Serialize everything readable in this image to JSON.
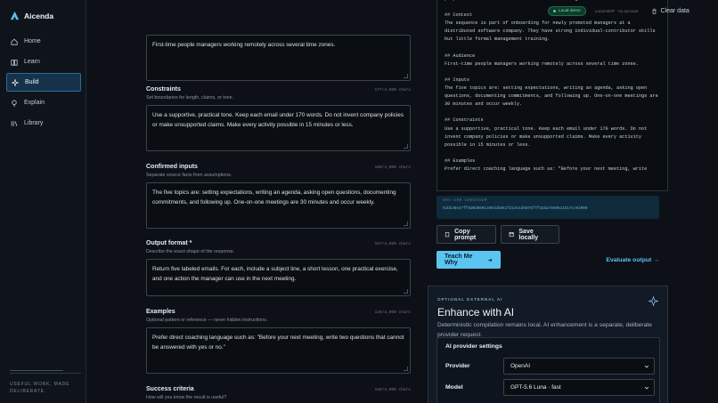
{
  "app": {
    "name": "Aicenda"
  },
  "sidebar": {
    "items": [
      {
        "label": "Home",
        "icon": "home-icon",
        "active": false
      },
      {
        "label": "Learn",
        "icon": "book-icon",
        "active": false
      },
      {
        "label": "Build",
        "icon": "sparkle-icon",
        "active": true
      },
      {
        "label": "Explain",
        "icon": "lightbulb-icon",
        "active": false
      },
      {
        "label": "Library",
        "icon": "library-icon",
        "active": false
      }
    ],
    "tagline": "USEFUL WORK, MADE DELIBERATE."
  },
  "form": {
    "audience_value": "First-time people managers working remotely across several time zones.",
    "constraints": {
      "label": "Constraints",
      "count": "177/4,000 chars",
      "desc": "Set boundaries for length, claims, or tone.",
      "value": "Use a supportive, practical tone. Keep each email under 170 words. Do not invent company policies or make unsupported claims. Make every activity possible in 15 minutes or less."
    },
    "inputs": {
      "label": "Confirmed inputs",
      "count": "180/4,000 chars",
      "desc": "Separate source facts from assumptions.",
      "value": "The five topics are: setting expectations, writing an agenda, asking open questions, documenting commitments, and following up. One-on-one meetings are 30 minutes and occur weekly."
    },
    "output": {
      "label": "Output format *",
      "count": "157/4,000 chars",
      "desc": "Describe the exact shape of the response.",
      "value": "Return five labeled emails. For each, include a subject line, a short lesson, one practical exercise, and one action the manager can use in the next meeting."
    },
    "examples": {
      "label": "Examples",
      "count": "120/4,000 chars",
      "desc": "Optional pattern or reference — never hidden instructions.",
      "value": "Prefer direct coaching language such as: \"Before your next meeting, write two questions that cannot be answered with yes or no.\""
    },
    "success": {
      "label": "Success criteria",
      "count": "158/4,000 chars",
      "desc": "How will you know the result is useful?"
    }
  },
  "topbar": {
    "demo_label": "Local demo",
    "mvp_note": "Local MVP · no account",
    "clear_label": "Clear data"
  },
  "output": {
    "text": "purpose for and can effective and in the meetings.\n\n## Context\nThe sequence is part of onboarding for newly promoted managers at a distributed software company. They have strong individual-contributor skills but little formal management training.\n\n## Audience\nFirst-time people managers working remotely across several time zones.\n\n## Inputs\nThe five topics are: setting expectations, writing an agenda, asking open questions, documenting commitments, and following up. One-on-one meetings are 30 minutes and occur weekly.\n\n## Constraints\nUse a supportive, practical tone. Keep each email under 170 words. Do not invent company policies or make unsupported claims. Make every activity possible in 15 minutes or less.\n\n## Examples\nPrefer direct coaching language such as: \"Before your next meeting, write",
    "checksum_label": "SHA-256 CHECKSUM",
    "checksum_value": "51bb48e47ff6d0d8001399cbb861f213e1d5875f7f32ba78e0621517cc02000",
    "copy_label": "Copy prompt",
    "save_label": "Save locally",
    "teach_label": "Teach Me Why",
    "eval_label": "Evaluate output"
  },
  "enhance": {
    "eyebrow": "OPTIONAL EXTERNAL AI",
    "title": "Enhance with AI",
    "desc": "Deterministic compilation remains local. AI enhancement is a separate, deliberate provider request.",
    "card_title": "AI provider settings",
    "provider_label": "Provider",
    "provider_value": "OpenAI",
    "model_label": "Model",
    "model_value": "GPT-5.6 Luna · fast"
  },
  "colors": {
    "accent": "#5cc4f0",
    "background": "#0d1117",
    "success": "#4fd694"
  }
}
